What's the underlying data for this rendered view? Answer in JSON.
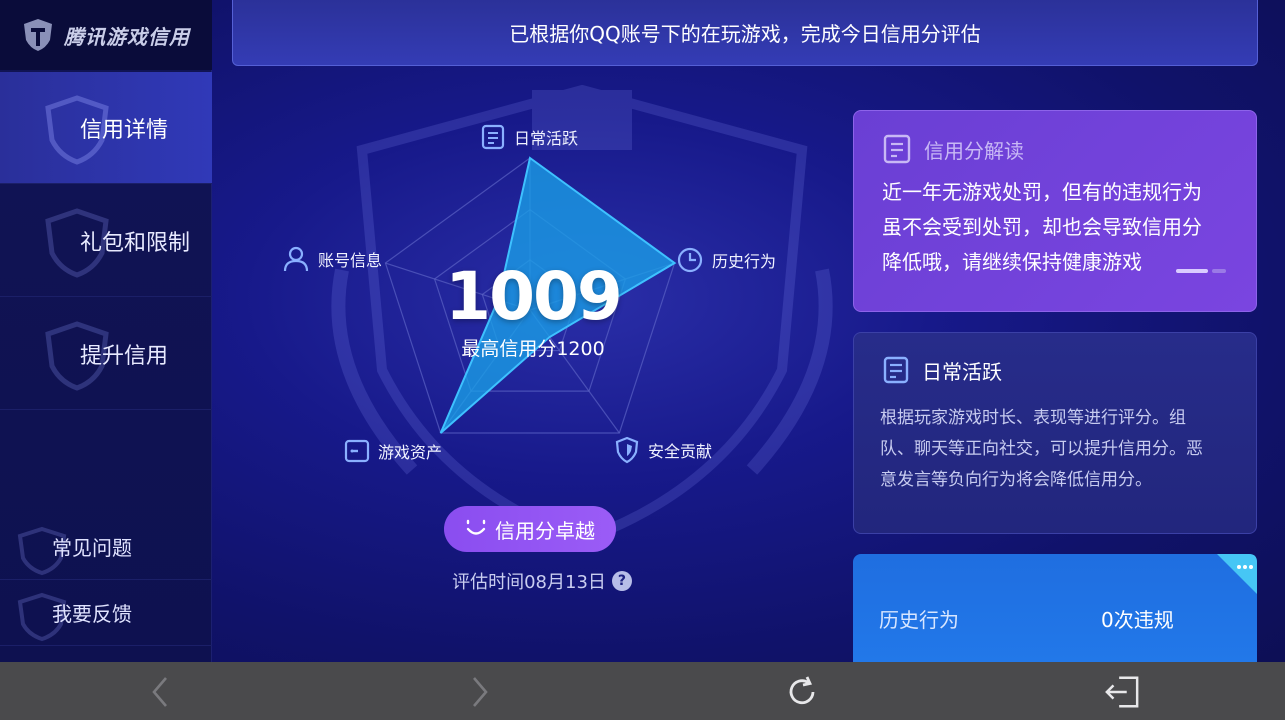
{
  "app": {
    "logo_text": "腾讯游戏信用"
  },
  "sidebar": {
    "items": [
      {
        "label": "信用详情"
      },
      {
        "label": "礼包和限制"
      },
      {
        "label": "提升信用"
      }
    ],
    "footer_items": [
      {
        "label": "常见问题"
      },
      {
        "label": "我要反馈"
      }
    ]
  },
  "banner": {
    "text": "已根据你QQ账号下的在玩游戏，完成今日信用分评估"
  },
  "radar": {
    "axes": [
      {
        "label": "日常活跃",
        "icon": "document-icon"
      },
      {
        "label": "历史行为",
        "icon": "clock-icon"
      },
      {
        "label": "安全贡献",
        "icon": "shield-icon"
      },
      {
        "label": "游戏资产",
        "icon": "wallet-icon"
      },
      {
        "label": "账号信息",
        "icon": "user-icon"
      }
    ],
    "values": [
      1.0,
      1.0,
      0.22,
      1.0,
      0.22
    ],
    "score": "1009",
    "max_score_text": "最高信用分1200",
    "fill_color": "#1aa0e8",
    "stroke_color": "#3ec1ff"
  },
  "rank_button": {
    "label": "信用分卓越"
  },
  "eval_time": {
    "text": "评估时间08月13日",
    "help": "?"
  },
  "cards": {
    "interpretation": {
      "title": "信用分解读",
      "body_lines": [
        "近一年无游戏处罚，但有的违规行为",
        "虽不会受到处罚，却也会导致信用分",
        "降低哦，请继续保持健康游戏"
      ]
    },
    "daily": {
      "title": "日常活跃",
      "body_lines": [
        "根据玩家游戏时长、表现等进行评分。组",
        "队、聊天等正向社交，可以提升信用分。恶",
        "意发言等负向行为将会降低信用分。"
      ]
    },
    "history": {
      "label": "历史行为",
      "value": "0次违规"
    }
  },
  "bottombar": {
    "buttons": [
      {
        "icon": "back-arrow-icon"
      },
      {
        "icon": "forward-arrow-icon"
      },
      {
        "icon": "refresh-icon"
      },
      {
        "icon": "exit-icon"
      }
    ]
  }
}
